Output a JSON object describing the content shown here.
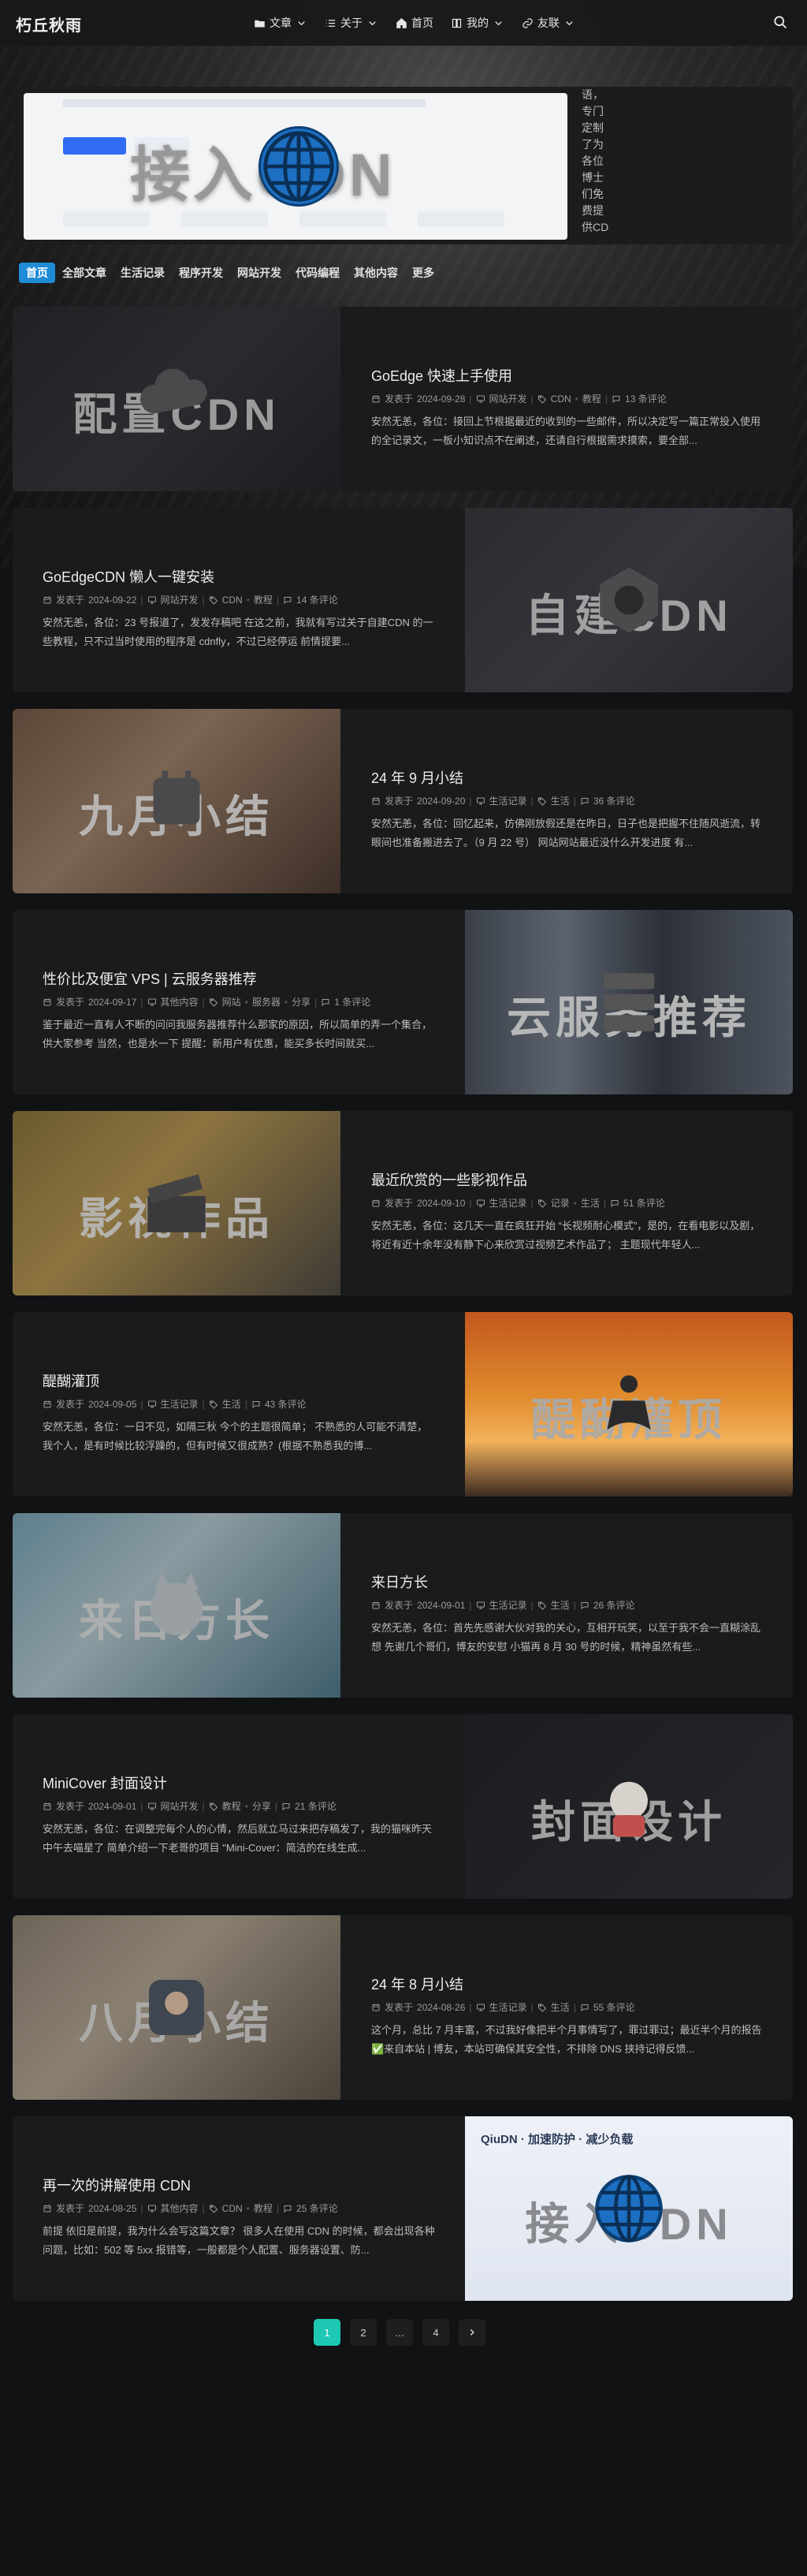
{
  "site": {
    "logo": "朽丘秋雨"
  },
  "nav": {
    "items": [
      {
        "label": "文章",
        "icon": "folder-open-icon"
      },
      {
        "label": "关于",
        "icon": "list-icon"
      },
      {
        "label": "首页",
        "icon": "home-icon"
      },
      {
        "label": "我的",
        "icon": "book-icon"
      },
      {
        "label": "友联",
        "icon": "link-icon"
      }
    ],
    "search_icon": "search-icon"
  },
  "banner": {
    "overlay_title": "接入CDN",
    "side_text": "语，专门定制了为各位博士们免费提供CD"
  },
  "tabs": [
    "首页",
    "全部文章",
    "生活记录",
    "程序开发",
    "网站开发",
    "代码编程",
    "其他内容",
    "更多"
  ],
  "posts": [
    {
      "title": "GoEdge 快速上手使用",
      "date_prefix": "发表于",
      "date": "2024-09-28",
      "category": "网站开发",
      "tags": [
        "CDN",
        "教程"
      ],
      "comments": "13 条评论",
      "excerpt": "安然无恙，各位：接回上节根据最近的收到的一些邮件，所以决定写一篇正常投入使用的全记录文，一板小知识点不在阐述，还请自行根据需求摸索，要全部...",
      "thumb_title": "配置CDN"
    },
    {
      "title": "GoEdgeCDN 懒人一键安装",
      "date_prefix": "发表于",
      "date": "2024-09-22",
      "category": "网站开发",
      "tags": [
        "CDN",
        "教程"
      ],
      "comments": "14 条评论",
      "excerpt": "安然无恙，各位：23 号报道了，发发存稿吧 在这之前，我就有写过关于自建CDN 的一些教程，只不过当时使用的程序是 cdnfly，不过已经停运 前情提要...",
      "thumb_title": "自建CDN"
    },
    {
      "title": "24 年 9 月小结",
      "date_prefix": "发表于",
      "date": "2024-09-20",
      "category": "生活记录",
      "tags": [
        "生活"
      ],
      "comments": "36 条评论",
      "excerpt": "安然无恙，各位：回忆起来，仿佛刚放假还是在昨日，日子也是把握不住随风逝流，转眼间也准备搬进去了。（9 月 22 号） 网站网站最近没什么开发进度 有...",
      "thumb_title": "九月小结"
    },
    {
      "title": "性价比及便宜 VPS | 云服务器推荐",
      "date_prefix": "发表于",
      "date": "2024-09-17",
      "category": "其他内容",
      "tags": [
        "网站",
        "服务器",
        "分享"
      ],
      "comments": "1 条评论",
      "excerpt": "鉴于最近一直有人不断的问问我服务器推荐什么那家的原因，所以简单的弄一个集合，供大家参考 当然，也是水一下 提醒：新用户有优惠，能买多长时间就买...",
      "thumb_title": "云服务推荐"
    },
    {
      "title": "最近欣赏的一些影视作品",
      "date_prefix": "发表于",
      "date": "2024-09-10",
      "category": "生活记录",
      "tags": [
        "记录",
        "生活"
      ],
      "comments": "51 条评论",
      "excerpt": "安然无恙，各位：这几天一直在疯狂开始 “长视频耐心模式”，是的，在看电影以及剧，将近有近十余年没有静下心来欣赏过视频艺术作品了； 主题现代年轻人...",
      "thumb_title": "影视作品"
    },
    {
      "title": "醍醐灌顶",
      "date_prefix": "发表于",
      "date": "2024-09-05",
      "category": "生活记录",
      "tags": [
        "生活"
      ],
      "comments": "43 条评论",
      "excerpt": "安然无恙，各位：一日不见，如隔三秋 今个的主题很简单； 不熟悉的人可能不清楚，我个人，是有时候比较浮躁的，但有时候又很成熟？(根据不熟悉我的博...",
      "thumb_title": "醍醐灌顶"
    },
    {
      "title": "来日方长",
      "date_prefix": "发表于",
      "date": "2024-09-01",
      "category": "生活记录",
      "tags": [
        "生活"
      ],
      "comments": "26 条评论",
      "excerpt": "安然无恙，各位：首先先感谢大伙对我的关心，互相开玩笑，以至于我不会一直糊涂乱想 先谢几个哥们，博友的安慰 小猫再 8 月 30 号的时候，精神虽然有些...",
      "thumb_title": "来日方长"
    },
    {
      "title": "MiniCover 封面设计",
      "date_prefix": "发表于",
      "date": "2024-09-01",
      "category": "网站开发",
      "tags": [
        "教程",
        "分享"
      ],
      "comments": "21 条评论",
      "excerpt": "安然无恙，各位：在调整完每个人的心情，然后就立马过来把存稿发了，我的猫咪昨天中午去喵星了 简单介绍一下老哥的项目 \"Mini-Cover：简洁的在线生成...",
      "thumb_title": "封面设计"
    },
    {
      "title": "24 年 8 月小结",
      "date_prefix": "发表于",
      "date": "2024-08-26",
      "category": "生活记录",
      "tags": [
        "生活"
      ],
      "comments": "55 条评论",
      "excerpt": "这个月，总比 7 月丰富，不过我好像把半个月事情写了，罪过罪过；最近半个月的报告 ✅来自本站 | 博友，本站可确保其安全性，不排除 DNS 挟持记得反馈...",
      "thumb_title": "八月小结"
    },
    {
      "title": "再一次的讲解使用 CDN",
      "date_prefix": "发表于",
      "date": "2024-08-25",
      "category": "其他内容",
      "tags": [
        "CDN",
        "教程"
      ],
      "comments": "25 条评论",
      "excerpt": "前提 依旧是前提，我为什么会写这篇文章？ 很多人在使用 CDN 的时候，都会出现各种问题，比如：502 等 5xx 报错等，一般都是个人配置、服务器设置、防...",
      "thumb_title": "接入CDN",
      "thumb_caption": "QiuDN · 加速防护 · 减少负载"
    }
  ],
  "pagination": {
    "pages": [
      "1",
      "2",
      "…",
      "4"
    ],
    "current": "1",
    "next_icon": "chevron-right-icon"
  }
}
